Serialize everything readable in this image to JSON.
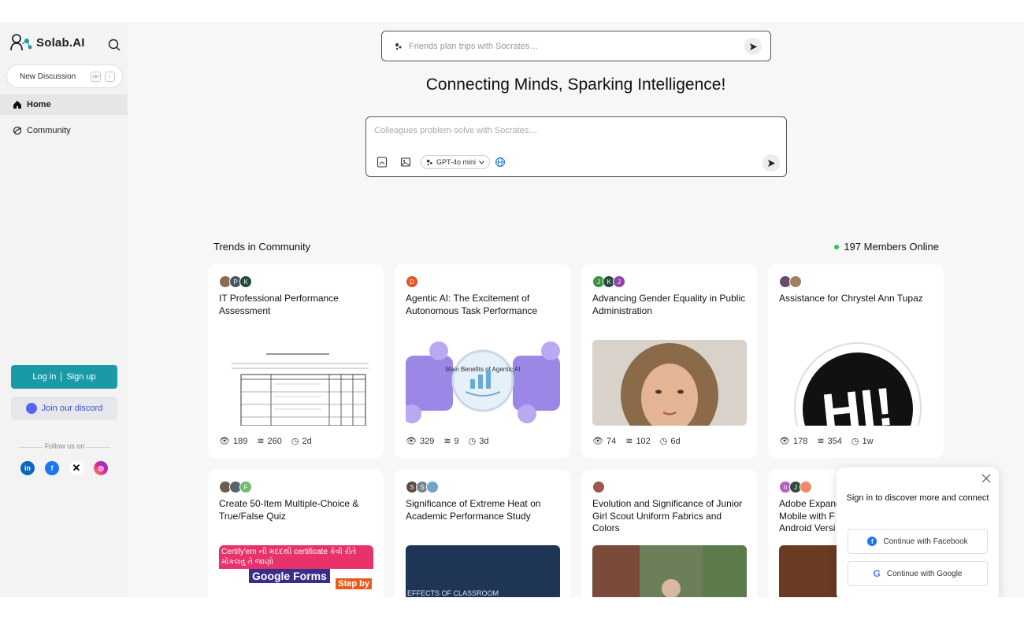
{
  "app": {
    "logo_text": "Solab.AI"
  },
  "sidebar": {
    "new_discussion": "New Discussion",
    "shortcut_keys": [
      "ctrl",
      "i"
    ],
    "nav": [
      {
        "label": "Home",
        "icon": "home-icon"
      },
      {
        "label": "Community",
        "icon": "community-icon"
      }
    ],
    "login_label": "Log in",
    "signup_label": "Sign up",
    "discord_label": "Join our discord",
    "follow_label": "Follow us on",
    "socials": [
      "linkedin-icon",
      "facebook-icon",
      "x-icon",
      "instagram-icon"
    ]
  },
  "search": {
    "placeholder": "Friends plan trips with Socrates…"
  },
  "headline": "Connecting Minds, Sparking Intelligence!",
  "compose": {
    "placeholder": "Colleagues problem-solve with Socrates…",
    "model": "GPT-4o mini"
  },
  "trends": {
    "title": "Trends in Community",
    "online": "197 Members Online"
  },
  "cards": [
    {
      "title": "IT Professional Performance Assessment",
      "avatars": [
        "",
        "P",
        "K"
      ],
      "views": "189",
      "layers": "260",
      "time": "2d"
    },
    {
      "title": "Agentic AI: The Excitement of Autonomous Task Performance",
      "avatars": [
        "D"
      ],
      "views": "329",
      "layers": "9",
      "time": "3d"
    },
    {
      "title": "Advancing Gender Equality in Public Administration",
      "avatars": [
        "J",
        "K",
        "J"
      ],
      "views": "74",
      "layers": "102",
      "time": "6d"
    },
    {
      "title": "Assistance for Chrystel Ann Tupaz",
      "avatars": [
        "",
        ""
      ],
      "views": "178",
      "layers": "354",
      "time": "1w"
    },
    {
      "title": "Create 50-Item Multiple-Choice & True/False Quiz",
      "avatars": [
        "",
        "",
        "F"
      ]
    },
    {
      "title": "Significance of Extreme Heat on Academic Performance Study",
      "avatars": [
        "S",
        "S",
        ""
      ]
    },
    {
      "title": "Evolution and Significance of Junior Girl Scout Uniform Fabrics and Colors",
      "avatars": [
        ""
      ]
    },
    {
      "title": "Adobe Expand Mobile with F Android Versi",
      "avatars": [
        "n",
        "J",
        ""
      ]
    }
  ],
  "card_images": {
    "agentic_center": "Main Benefits of Agentic AI",
    "forms_banner": "Certify'em ની મદદથી certificate કેવી રીતે મોકલવું તે જાણો",
    "forms_title": "Google Forms",
    "forms_step": "Step by",
    "heat_caption": "EFFECTS OF CLASSROOM",
    "hi_text": "HI!"
  },
  "popup": {
    "title": "Sign in to discover more and connect",
    "facebook": "Continue with Facebook",
    "google": "Continue with Google"
  }
}
